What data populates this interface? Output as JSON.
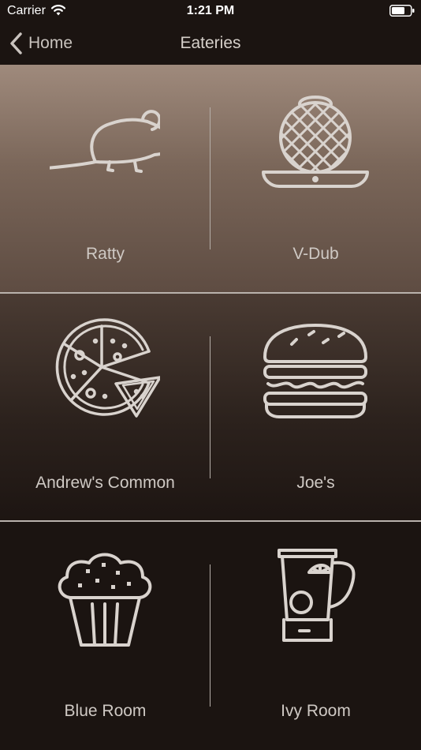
{
  "status_bar": {
    "carrier": "Carrier",
    "time": "1:21 PM",
    "wifi_icon": "wifi-icon",
    "battery_icon": "battery-icon"
  },
  "nav": {
    "back_label": "Home",
    "title": "Eateries"
  },
  "colors": {
    "background": "#1b1411",
    "line": "#d9d3ce",
    "text": "#cfc9c4"
  },
  "eateries": [
    {
      "label": "Ratty",
      "icon": "mouse-icon"
    },
    {
      "label": "V-Dub",
      "icon": "waffle-iron-icon"
    },
    {
      "label": "Andrew's Common",
      "icon": "pizza-icon"
    },
    {
      "label": "Joe's",
      "icon": "burger-icon"
    },
    {
      "label": "Blue Room",
      "icon": "muffin-icon"
    },
    {
      "label": "Ivy Room",
      "icon": "blender-icon"
    }
  ]
}
